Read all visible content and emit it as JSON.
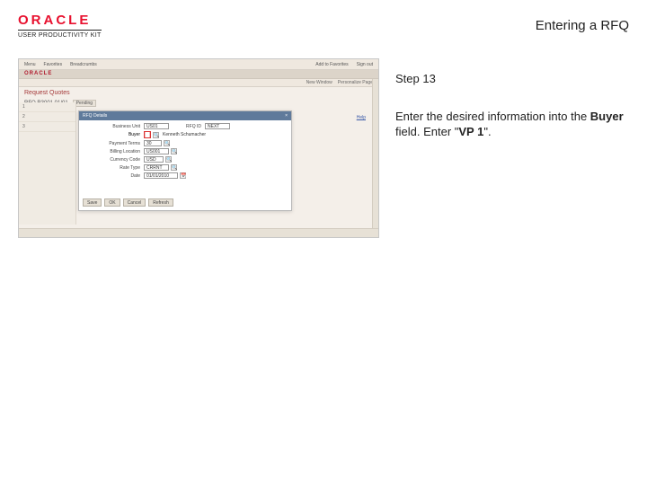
{
  "header": {
    "logo": "ORACLE",
    "logo_sub": "USER PRODUCTIVITY KIT",
    "title": "Entering a RFQ"
  },
  "step": {
    "label": "Step 13",
    "instruction_pre": "Enter the desired information into the ",
    "instruction_bold": "Buyer",
    "instruction_mid": " field. Enter \"",
    "instruction_value": "VP 1",
    "instruction_post": "\"."
  },
  "app": {
    "topnav": {
      "a": "Menu",
      "b": "Favorites",
      "c": "Breadcrumbs",
      "d": "Add to Favorites",
      "e": "Sign out"
    },
    "brand": "ORACLE",
    "row2": {
      "a": "New Window",
      "b": "Personalize Page"
    },
    "panel_title": "Request Quotes",
    "sub": {
      "label": "RFQ R3001 01/01",
      "p": "Pending"
    },
    "help": "Help",
    "form": {
      "win_title": "RFQ Details",
      "win_close": "×",
      "bu_label": "Business Unit",
      "bu_value": "US01",
      "rfq_label": "RFQ ID",
      "rfq_value": "NEXT",
      "buyer_label": "Buyer",
      "buyer_value": "",
      "buyer_name": "Kenneth Schumacher",
      "pay_label": "Payment Terms",
      "pay_value": "30",
      "bill_label": "Billing Location",
      "bill_value": "US001",
      "curr_label": "Currency Code",
      "curr_value": "USD",
      "rate_label": "Rate Type",
      "rate_value": "CRRNT",
      "date_label": "Date",
      "date_value": "01/01/2010"
    },
    "buttons": {
      "save": "Save",
      "ok": "OK",
      "cancel": "Cancel",
      "refresh": "Refresh"
    }
  }
}
